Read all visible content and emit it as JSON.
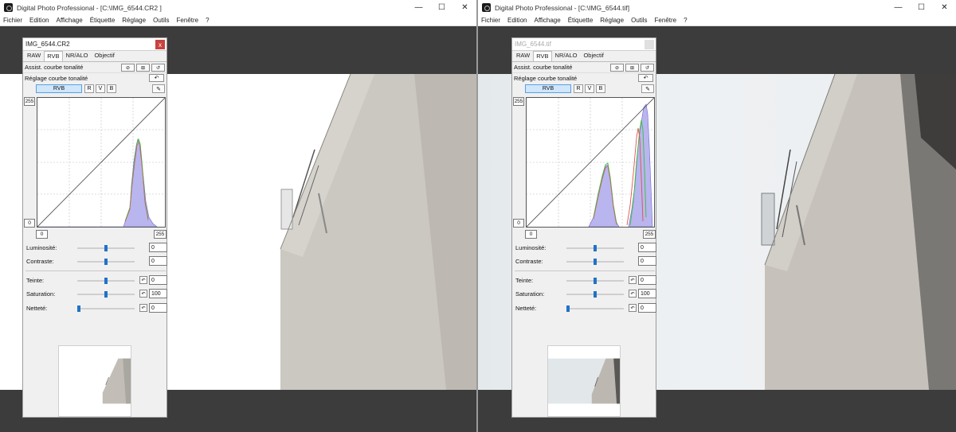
{
  "left": {
    "window_title": "Digital Photo Professional - [C:\\IMG_6544.CR2 ]",
    "panel_title": "IMG_6544.CR2",
    "panel_active": true,
    "window_close_glyph": "✕",
    "sliders": [
      {
        "label": "Luminosité:",
        "value": "0",
        "level": 0.5
      },
      {
        "label": "Contraste:",
        "value": "0",
        "level": 0.5
      },
      {
        "label": "Teinte:",
        "value": "0",
        "level": 0.5
      },
      {
        "label": "Saturation:",
        "value": "100",
        "level": 0.5
      },
      {
        "label": "Netteté:",
        "value": "0",
        "level": 0.0
      }
    ]
  },
  "right": {
    "window_title": "Digital Photo Professional - [C:\\IMG_6544.tif]",
    "panel_title": "IMG_6544.tif",
    "panel_active": false,
    "window_close_glyph": "✕",
    "sliders": [
      {
        "label": "Luminosité:",
        "value": "0",
        "level": 0.5
      },
      {
        "label": "Contraste:",
        "value": "0",
        "level": 0.5
      },
      {
        "label": "Teinte:",
        "value": "0",
        "level": 0.5
      },
      {
        "label": "Saturation:",
        "value": "100",
        "level": 0.5
      },
      {
        "label": "Netteté:",
        "value": "0",
        "level": 0.0
      }
    ]
  },
  "menu": [
    "Fichier",
    "Edition",
    "Affichage",
    "Étiquette",
    "Réglage",
    "Outils",
    "Fenêtre",
    "?"
  ],
  "window_controls": {
    "minimize": "—",
    "maximize": "☐"
  },
  "tabs": [
    "RAW",
    "RVB",
    "NR/ALO",
    "Objectif"
  ],
  "active_tab": "RVB",
  "assist_label": "Assist. courbe tonalité",
  "curve_label": "Réglage courbe tonalité",
  "channels": {
    "all": "RVB",
    "r": "R",
    "v": "V",
    "b": "B"
  },
  "hist_top_value": "255",
  "hist_bottom_value": "0",
  "input_min": "0",
  "input_max": "255",
  "colors": {
    "panel_bg": "#f0f0f0",
    "window_bg": "#3c3c3c",
    "accent_thumb": "#1f73c7",
    "close_red": "#c8423e",
    "hist_blue": "#b9b5ee",
    "hist_green": "#3cbf3c",
    "hist_red": "#e05050"
  },
  "icons": {
    "app": "app-icon",
    "close": "close-icon",
    "reset": "undo-icon",
    "eyedropper": "eyedropper-icon"
  }
}
